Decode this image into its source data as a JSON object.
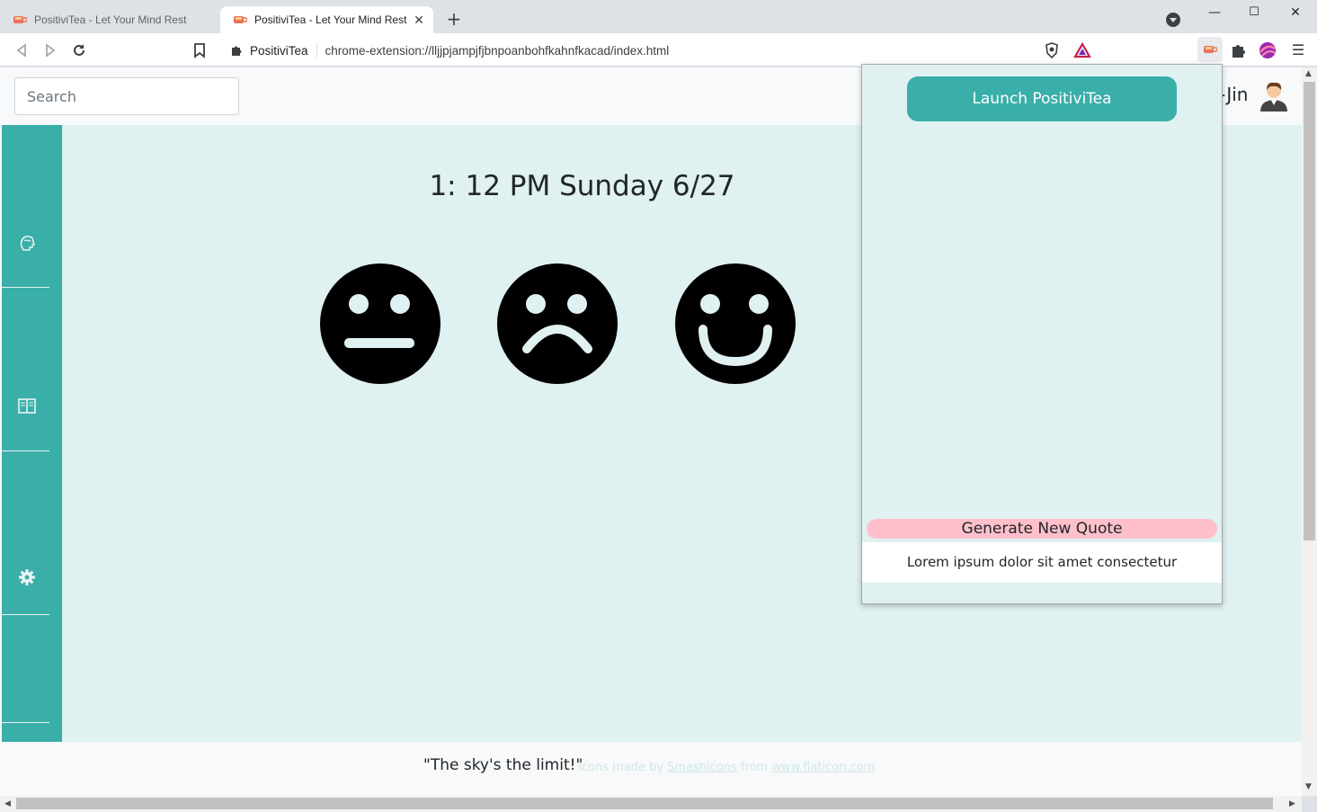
{
  "browser": {
    "tabs": [
      {
        "title": "PositiviTea - Let Your Mind Rest",
        "active": false
      },
      {
        "title": "PositiviTea - Let Your Mind Rest",
        "active": true
      }
    ],
    "omnibox": {
      "site_label": "PositiviTea",
      "url": "chrome-extension://lljjpjampjfjbnpoanbohfkahnfkacad/index.html"
    }
  },
  "header": {
    "search_placeholder": "Search",
    "username": "-Jin"
  },
  "sidebar": {
    "items": [
      {
        "icon": "brain-head-icon"
      },
      {
        "icon": "journal-book-icon"
      },
      {
        "icon": "gear-icon"
      }
    ]
  },
  "main": {
    "datetime": "1: 12 PM Sunday 6/27",
    "moods": [
      "neutral-face-icon",
      "sad-face-icon",
      "happy-face-icon"
    ]
  },
  "footer": {
    "quote": "\"The sky's the limit!\"",
    "credit_prefix": "Icons made by ",
    "credit_author": "Smashicons",
    "credit_mid": " from ",
    "credit_site": "www.flaticon.com"
  },
  "popup": {
    "launch_label": "Launch PositiviTea",
    "generate_label": "Generate New Quote",
    "quote_text": "Lorem ipsum dolor sit amet consectetur"
  },
  "colors": {
    "teal": "#3aaea9",
    "mint": "#dff1f0",
    "pink": "#ffc0cb"
  }
}
